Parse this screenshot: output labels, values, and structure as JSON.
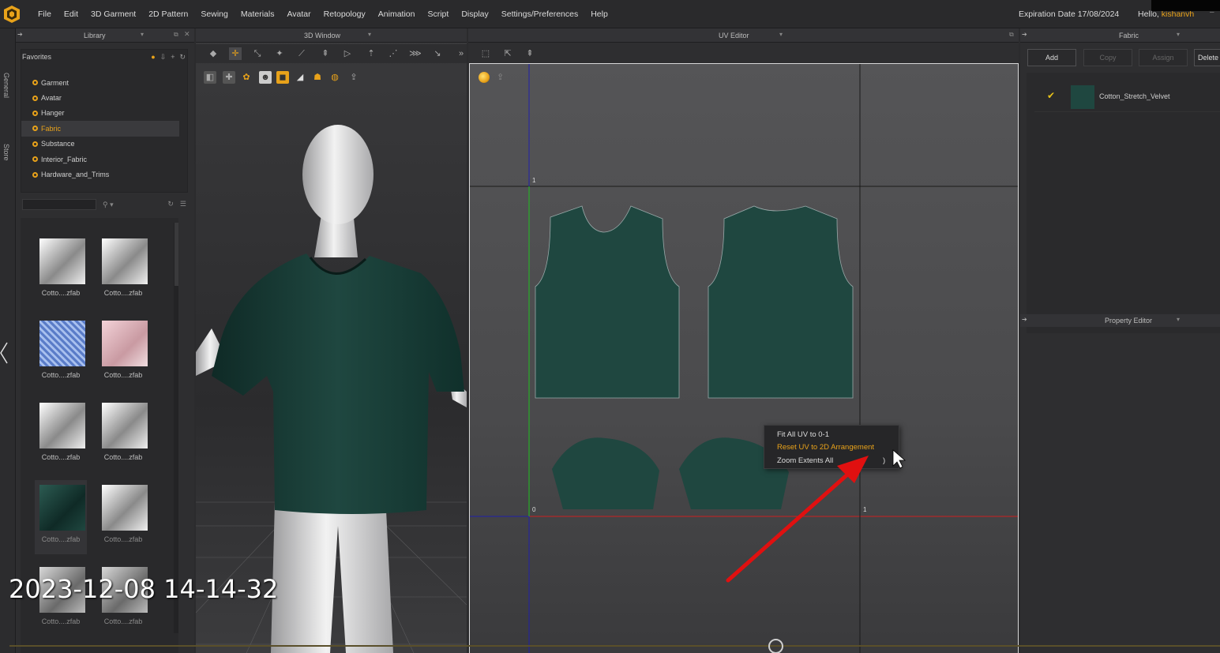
{
  "menubar": {
    "items": [
      "File",
      "Edit",
      "3D Garment",
      "2D Pattern",
      "Sewing",
      "Materials",
      "Avatar",
      "Retopology",
      "Animation",
      "Script",
      "Display",
      "Settings/Preferences",
      "Help"
    ],
    "expiration": "Expiration Date 17/08/2024",
    "hello": "Hello,",
    "username": "kishanvh"
  },
  "side_tabs": {
    "general": "General",
    "store": "Store"
  },
  "library": {
    "title": "Library",
    "favorites_title": "Favorites",
    "favorites": [
      "Garment",
      "Avatar",
      "Hanger",
      "Fabric",
      "Substance",
      "Interior_Fabric",
      "Hardware_and_Trims"
    ],
    "selected_favorite": "Fabric",
    "thumbnails": [
      "Cotto....zfab",
      "Cotto....zfab",
      "Cotto....zfab",
      "Cotto....zfab",
      "Cotto....zfab",
      "Cotto....zfab",
      "Cotto....zfab",
      "Cotto....zfab",
      "Cotto....zfab",
      "Cotto....zfab"
    ]
  },
  "window3d": {
    "title": "3D Window"
  },
  "uv_editor": {
    "title": "UV Editor",
    "axis_labels": {
      "top_one": "1",
      "origin": "0",
      "right_one": "1"
    },
    "context_menu": {
      "items": [
        "Fit All UV to 0-1",
        "Reset UV to 2D Arrangement",
        "Zoom Extents All"
      ],
      "highlighted": "Reset UV to 2D Arrangement",
      "shortcut": ")"
    }
  },
  "fabric_panel": {
    "title": "Fabric",
    "buttons": {
      "add": "Add",
      "copy": "Copy",
      "assign": "Assign",
      "delete": "Delete"
    },
    "items": [
      {
        "name": "Cotton_Stretch_Velvet",
        "checked": true,
        "swatch_color": "#1f4740"
      }
    ]
  },
  "property_editor": {
    "title": "Property Editor"
  },
  "overlay": {
    "timestamp": "2023-12-08 14-14-32"
  },
  "colors": {
    "accent": "#e8a21a",
    "fabric": "#1f4740",
    "annotation_arrow": "#e01010"
  }
}
